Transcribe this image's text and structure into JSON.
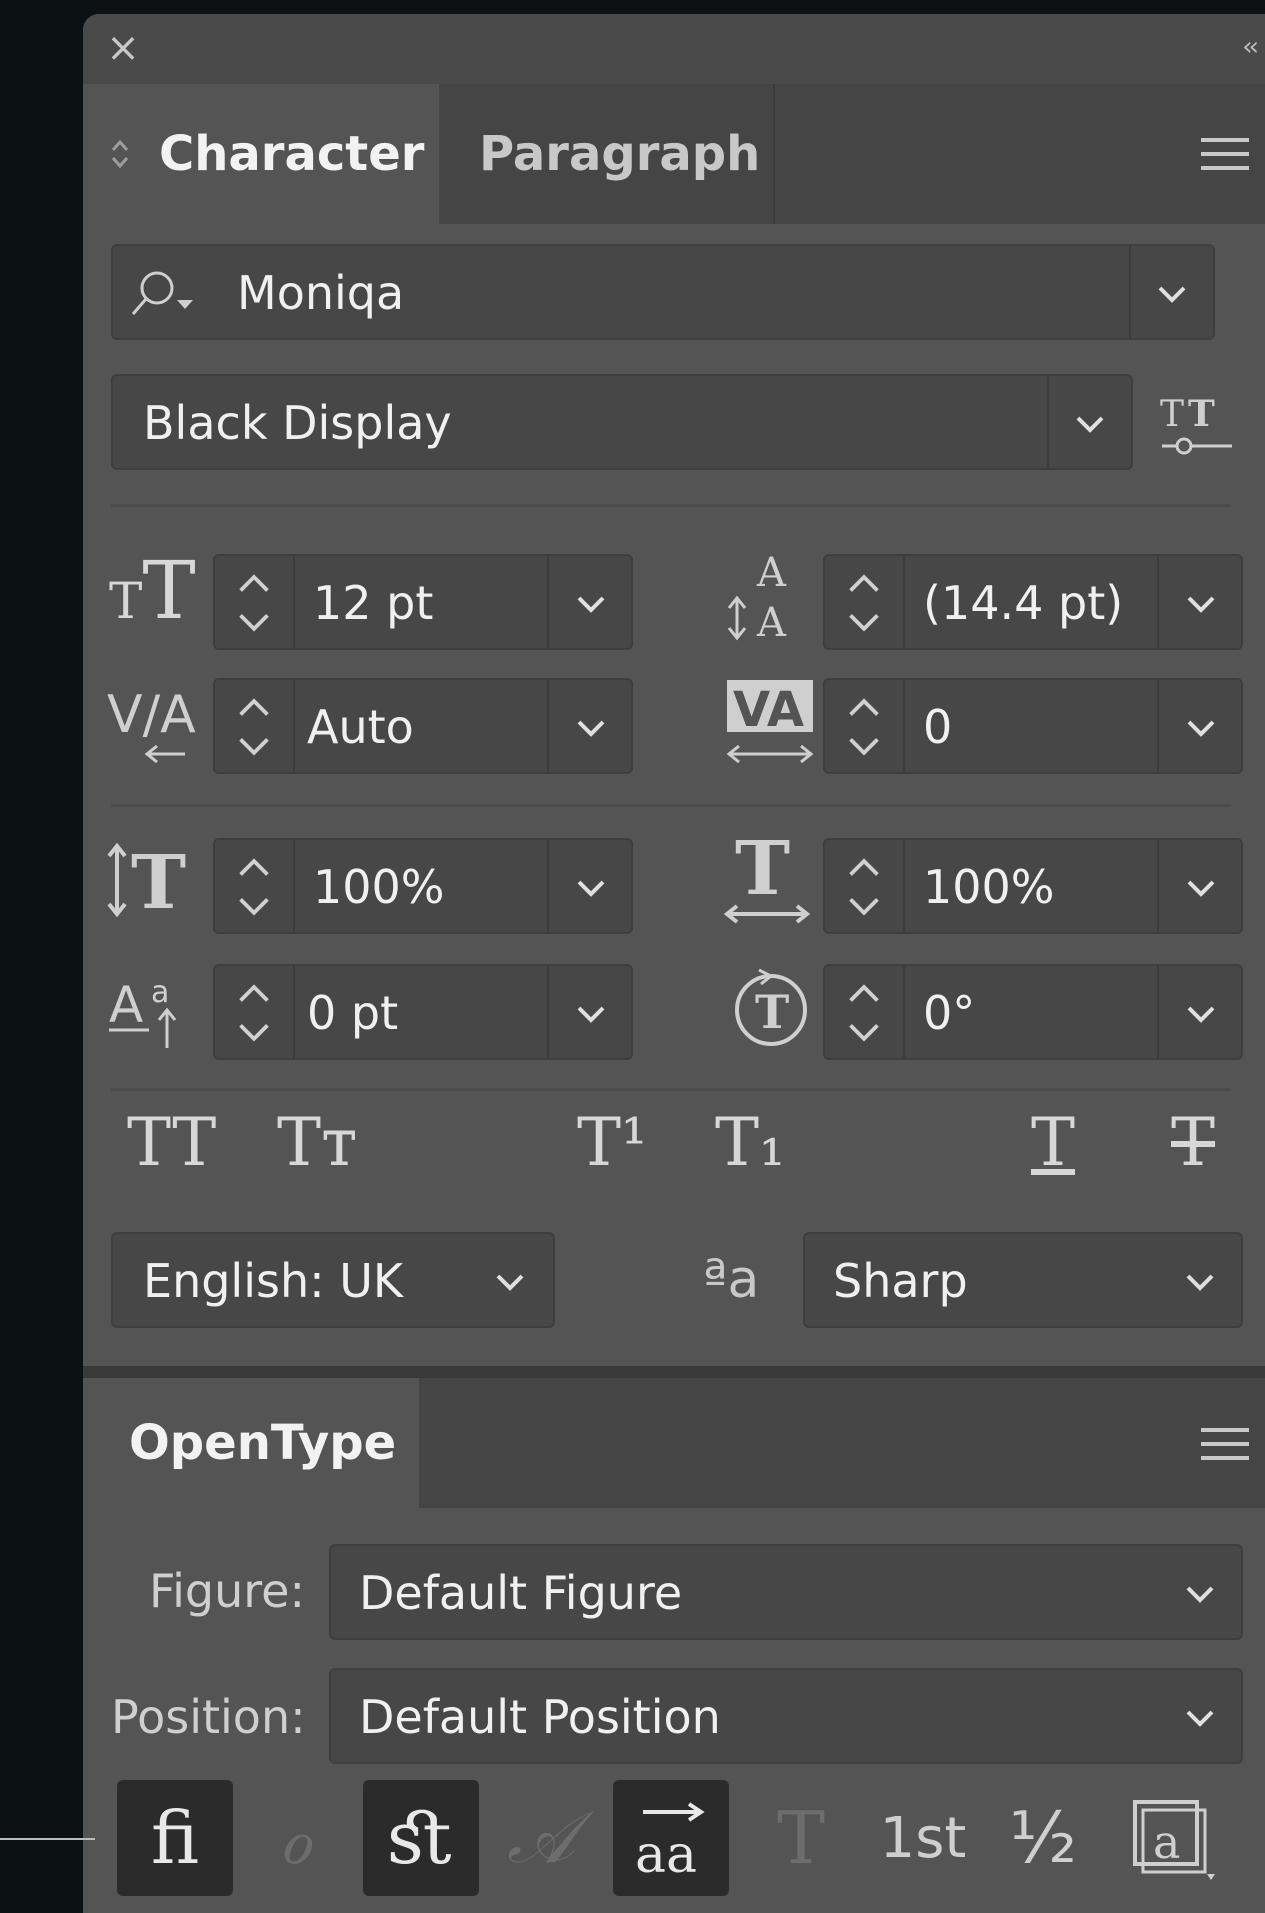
{
  "tabs": {
    "character": "Character",
    "paragraph": "Paragraph"
  },
  "font_family": {
    "value": "Moniqa"
  },
  "font_style": {
    "value": "Black Display"
  },
  "size": {
    "value": "12 pt"
  },
  "leading": {
    "value": "(14.4 pt)"
  },
  "kerning": {
    "value": "Auto"
  },
  "tracking": {
    "value": "0"
  },
  "vertical_scale": {
    "value": "100%"
  },
  "horizontal_scale": {
    "value": "100%"
  },
  "baseline_shift": {
    "value": "0 pt"
  },
  "rotation": {
    "value": "0°"
  },
  "style_buttons": {
    "all_caps": "TT",
    "small_caps": "Tᴛ",
    "superscript": "T¹",
    "subscript": "T₁",
    "underline": "T",
    "strikethrough": "T"
  },
  "language": {
    "value": "English: UK"
  },
  "antialias": {
    "icon_text": "ªa",
    "value": "Sharp"
  },
  "opentype": {
    "title": "OpenType",
    "figure_label": "Figure:",
    "figure_value": "Default Figure",
    "position_label": "Position:",
    "position_value": "Default Position",
    "buttons": [
      "ﬁ",
      "ℴ",
      "ﬆ",
      "𝒜",
      "aa",
      "T",
      "1st",
      "½",
      "a"
    ]
  },
  "colors": {
    "panel": "#545454",
    "tabbar": "#454545",
    "field": "#474747",
    "background": "#0c1114"
  }
}
